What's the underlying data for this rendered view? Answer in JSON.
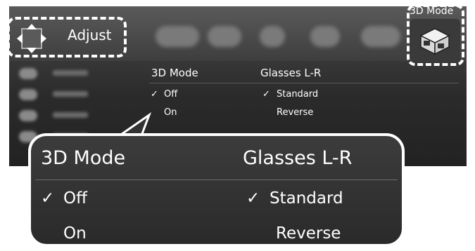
{
  "header": {
    "adjust_label": "Adjust",
    "mode_label": "3D Mode"
  },
  "dropdown": {
    "col1_title": "3D Mode",
    "col2_title": "Glasses L-R",
    "off": "Off",
    "on": "On",
    "standard": "Standard",
    "reverse": "Reverse",
    "check": "✓"
  },
  "callout": {
    "col1_title": "3D Mode",
    "col2_title": "Glasses L-R",
    "off": "Off",
    "on": "On",
    "standard": "Standard",
    "reverse": "Reverse",
    "check": "✓"
  },
  "colors": {
    "background": "#2b2b2b",
    "text": "#ffffff",
    "dash": "#ffffff"
  },
  "icons": [
    "dpad-icon",
    "3d-glasses-icon"
  ]
}
